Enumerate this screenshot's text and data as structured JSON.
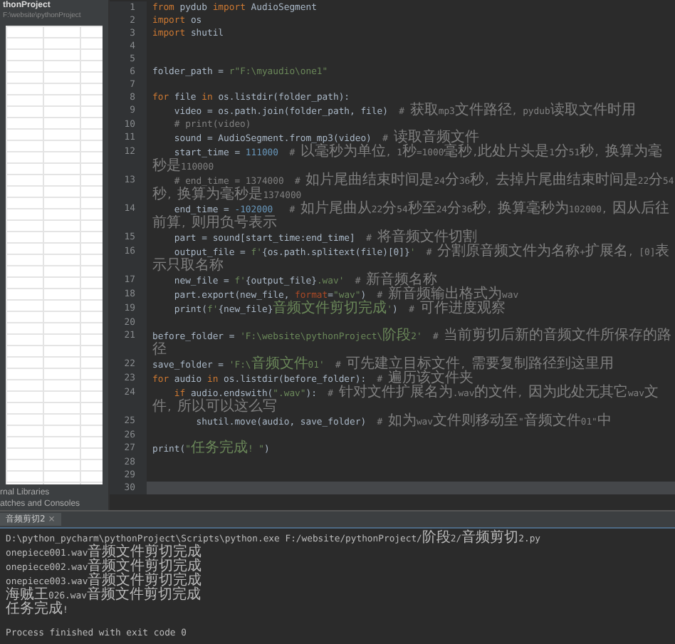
{
  "project_panel": {
    "title": "thonProject",
    "path": "F:\\website\\pythonProject",
    "items": [
      {
        "label": "rnal Libraries"
      },
      {
        "label": "atches and Consoles"
      }
    ]
  },
  "editor": {
    "lines": [
      {
        "number": "1",
        "current": false,
        "tokens": [
          {
            "kind": "keyword",
            "text": "from"
          },
          {
            "kind": "plain",
            "text": " pydub "
          },
          {
            "kind": "keyword",
            "text": "import"
          },
          {
            "kind": "plain",
            "text": " AudioSegment"
          }
        ]
      },
      {
        "number": "2",
        "current": false,
        "tokens": [
          {
            "kind": "keyword",
            "text": "import"
          },
          {
            "kind": "plain",
            "text": " os"
          }
        ]
      },
      {
        "number": "3",
        "current": false,
        "tokens": [
          {
            "kind": "keyword",
            "text": "import"
          },
          {
            "kind": "plain",
            "text": " shutil"
          }
        ]
      },
      {
        "number": "4",
        "current": false
      },
      {
        "number": "5",
        "current": false
      },
      {
        "number": "6",
        "current": false,
        "tokens": [
          {
            "kind": "plain",
            "text": "folder_path = "
          },
          {
            "kind": "string",
            "text": "r\"F:\\myaudio\\one1\""
          }
        ]
      },
      {
        "number": "7",
        "current": false
      },
      {
        "number": "8",
        "current": false,
        "tokens": [
          {
            "kind": "keyword",
            "text": "for"
          },
          {
            "kind": "plain",
            "text": " file "
          },
          {
            "kind": "keyword",
            "text": "in"
          },
          {
            "kind": "plain",
            "text": " os.listdir(folder_path):"
          }
        ]
      },
      {
        "number": "9",
        "current": false,
        "tokens": [
          {
            "kind": "plain",
            "text": "    video = os.path.join(folder_path, file)  "
          },
          {
            "kind": "comment",
            "text": "# 获取mp3文件路径, pydub读取文件时用"
          }
        ]
      },
      {
        "number": "10",
        "current": false,
        "tokens": [
          {
            "kind": "comment",
            "text": "    # print(video)"
          }
        ]
      },
      {
        "number": "11",
        "current": false,
        "tokens": [
          {
            "kind": "plain",
            "text": "    sound = AudioSegment.from_mp3(video)  "
          },
          {
            "kind": "comment",
            "text": "# 读取音频文件"
          }
        ]
      },
      {
        "number": "12",
        "current": false,
        "tokens": [
          {
            "kind": "plain",
            "text": "    start_time = "
          },
          {
            "kind": "number",
            "text": "111000"
          },
          {
            "kind": "comment",
            "text": "  # 以毫秒为单位, 1秒=1000毫秒,此处片头是1分51秒, 换算为毫秒是110000"
          }
        ]
      },
      {
        "number": "13",
        "current": false,
        "tokens": [
          {
            "kind": "comment",
            "text": "    # end_time = 1374000  # 如片尾曲结束时间是24分36秒, 去掉片尾曲结束时间是22分54秒, 换算为毫秒是1374000"
          }
        ]
      },
      {
        "number": "14",
        "current": false,
        "tokens": [
          {
            "kind": "plain",
            "text": "    end_time = "
          },
          {
            "kind": "number",
            "text": "-102000"
          },
          {
            "kind": "comment",
            "text": "   # 如片尾曲从22分54秒至24分36秒, 换算毫秒为102000, 因从后往前算, 则用负号表示"
          }
        ]
      },
      {
        "number": "15",
        "current": false,
        "tokens": [
          {
            "kind": "plain",
            "text": "    part = sound[start_time:end_time]  "
          },
          {
            "kind": "comment",
            "text": "# 将音频文件切割"
          }
        ]
      },
      {
        "number": "16",
        "current": false,
        "tokens": [
          {
            "kind": "plain",
            "text": "    output_file = "
          },
          {
            "kind": "string",
            "text": "f'"
          },
          {
            "kind": "plain",
            "text": "{os.path.splitext(file)[0]}"
          },
          {
            "kind": "string",
            "text": "'"
          },
          {
            "kind": "comment",
            "text": "  # 分割原音频文件为名称+扩展名, [0]表示只取名称"
          }
        ]
      },
      {
        "number": "17",
        "current": false,
        "tokens": [
          {
            "kind": "plain",
            "text": "    new_file = "
          },
          {
            "kind": "string",
            "text": "f'"
          },
          {
            "kind": "plain",
            "text": "{output_file}"
          },
          {
            "kind": "string",
            "text": ".wav'"
          },
          {
            "kind": "comment",
            "text": "  # 新音频名称"
          }
        ]
      },
      {
        "number": "18",
        "current": false,
        "tokens": [
          {
            "kind": "plain",
            "text": "    part.export(new_file, "
          },
          {
            "kind": "param",
            "text": "format"
          },
          {
            "kind": "plain",
            "text": "="
          },
          {
            "kind": "string",
            "text": "\"wav\""
          },
          {
            "kind": "plain",
            "text": ")  "
          },
          {
            "kind": "comment",
            "text": "# 新音频输出格式为wav"
          }
        ]
      },
      {
        "number": "19",
        "current": false,
        "tokens": [
          {
            "kind": "plain",
            "text": "    print("
          },
          {
            "kind": "string",
            "text": "f'"
          },
          {
            "kind": "plain",
            "text": "{new_file}"
          },
          {
            "kind": "string",
            "text": "音频文件剪切完成'"
          },
          {
            "kind": "plain",
            "text": ")  "
          },
          {
            "kind": "comment",
            "text": "# 可作进度观察"
          }
        ]
      },
      {
        "number": "20",
        "current": false
      },
      {
        "number": "21",
        "current": false,
        "tokens": [
          {
            "kind": "plain",
            "text": "before_folder = "
          },
          {
            "kind": "string",
            "text": "'F:\\website\\pythonProject\\阶段2'"
          },
          {
            "kind": "comment",
            "text": "  # 当前剪切后新的音频文件所保存的路径"
          }
        ]
      },
      {
        "number": "22",
        "current": false,
        "tokens": [
          {
            "kind": "plain",
            "text": "save_folder = "
          },
          {
            "kind": "string",
            "text": "'F:\\音频文件01'"
          },
          {
            "kind": "comment",
            "text": "  # 可先建立目标文件, 需要复制路径到这里用"
          }
        ]
      },
      {
        "number": "23",
        "current": false,
        "tokens": [
          {
            "kind": "keyword",
            "text": "for"
          },
          {
            "kind": "plain",
            "text": " audio "
          },
          {
            "kind": "keyword",
            "text": "in"
          },
          {
            "kind": "plain",
            "text": " os.listdir(before_folder):  "
          },
          {
            "kind": "comment",
            "text": "# 遍历该文件夹"
          }
        ]
      },
      {
        "number": "24",
        "current": false,
        "tokens": [
          {
            "kind": "keyword",
            "text": "    if"
          },
          {
            "kind": "plain",
            "text": " audio.endswith("
          },
          {
            "kind": "string",
            "text": "\".wav\""
          },
          {
            "kind": "plain",
            "text": "):  "
          },
          {
            "kind": "comment",
            "text": "# 针对文件扩展名为.wav的文件, 因为此处无其它wav文件, 所以可以这么写"
          }
        ]
      },
      {
        "number": "25",
        "current": false,
        "tokens": [
          {
            "kind": "plain",
            "text": "        shutil.move(audio, save_folder)  "
          },
          {
            "kind": "comment",
            "text": "# 如为wav文件则移动至\"音频文件01\"中"
          }
        ]
      },
      {
        "number": "26",
        "current": false
      },
      {
        "number": "27",
        "current": false,
        "tokens": [
          {
            "kind": "plain",
            "text": "print("
          },
          {
            "kind": "string",
            "text": "\"任务完成! \""
          },
          {
            "kind": "plain",
            "text": ")"
          }
        ]
      },
      {
        "number": "28",
        "current": false
      },
      {
        "number": "29",
        "current": false
      },
      {
        "number": "30",
        "current": true
      }
    ]
  },
  "run_panel": {
    "tab": {
      "label": "音频剪切2",
      "close": "×"
    },
    "output": [
      "D:\\python_pycharm\\pythonProject\\Scripts\\python.exe F:/website/pythonProject/阶段2/音频剪切2.py",
      "onepiece001.wav音频文件剪切完成",
      "onepiece002.wav音频文件剪切完成",
      "onepiece003.wav音频文件剪切完成",
      "海贼王026.wav音频文件剪切完成",
      "任务完成!"
    ],
    "exit_message": "Process finished with exit code 0"
  }
}
